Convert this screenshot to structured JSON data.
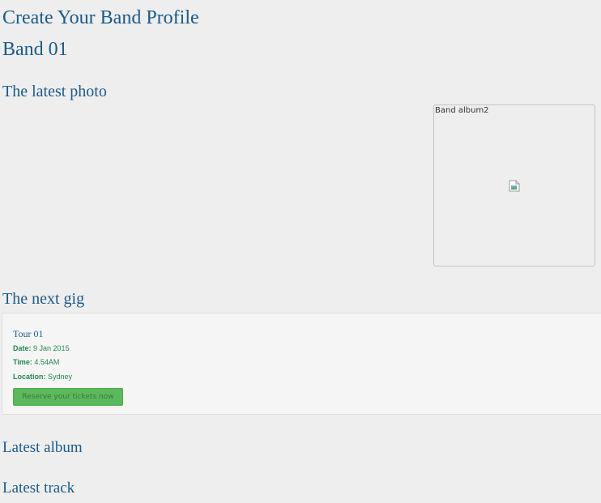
{
  "page": {
    "title": "Create Your Band Profile",
    "band_name": "Band 01"
  },
  "latest_photo": {
    "heading": "The latest photo",
    "image_alt": "Band album2",
    "image_icon": "broken-image-icon"
  },
  "next_gig": {
    "heading": "The next gig",
    "tour_name": "Tour 01",
    "date_label": "Date:",
    "date_value": "9 Jan 2015",
    "time_label": "Time:",
    "time_value": "4.54AM",
    "location_label": "Location:",
    "location_value": "Sydney",
    "reserve_button": "Reserve your tickets now"
  },
  "latest_album": {
    "heading": "Latest album"
  },
  "latest_track": {
    "heading": "Latest track"
  },
  "colors": {
    "background": "#eeeeee",
    "heading": "#1b5a8a",
    "detail_text": "#24894e",
    "button": "#5cb85c",
    "card": "#f5f5f5"
  }
}
